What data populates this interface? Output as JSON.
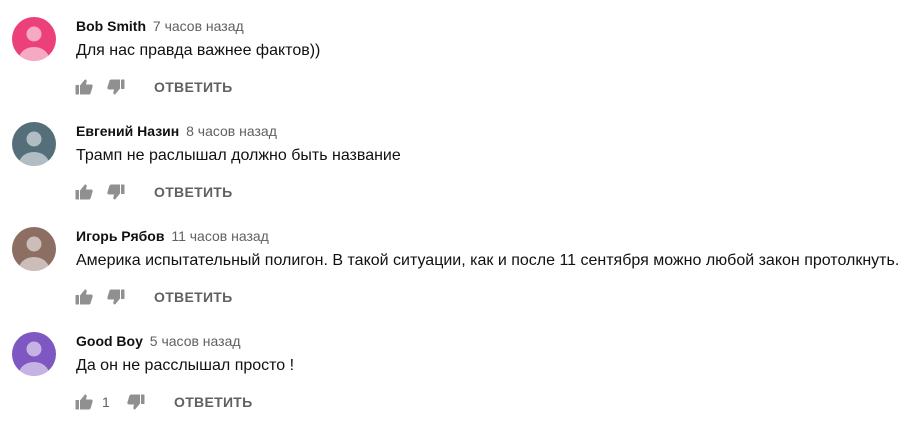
{
  "comments": [
    {
      "author": "Bob Smith",
      "time": "7 часов назад",
      "text": "Для нас правда важнее фактов))",
      "likes": "",
      "reply_label": "ОТВЕТИТЬ",
      "avatar_color": "#ec407a"
    },
    {
      "author": "Евгений Назин",
      "time": "8 часов назад",
      "text": "Трамп не раслышал должно быть название",
      "likes": "",
      "reply_label": "ОТВЕТИТЬ",
      "avatar_color": "#546e7a"
    },
    {
      "author": "Игорь Рябов",
      "time": "11 часов назад",
      "text": "Америка испытательный полигон. В такой ситуации, как и после 11 сентября можно любой закон протолкнуть.",
      "likes": "",
      "reply_label": "ОТВЕТИТЬ",
      "avatar_color": "#8d6e63"
    },
    {
      "author": "Good Boy",
      "time": "5 часов назад",
      "text": "Да он не расслышал просто !",
      "likes": "1",
      "reply_label": "ОТВЕТИТЬ",
      "avatar_color": "#7e57c2"
    }
  ],
  "icons": {
    "like": "thumb-up-icon",
    "dislike": "thumb-down-icon",
    "avatar": "default-person-avatar"
  },
  "colors": {
    "author": "#111111",
    "meta": "#606060",
    "icon": "#909090"
  }
}
